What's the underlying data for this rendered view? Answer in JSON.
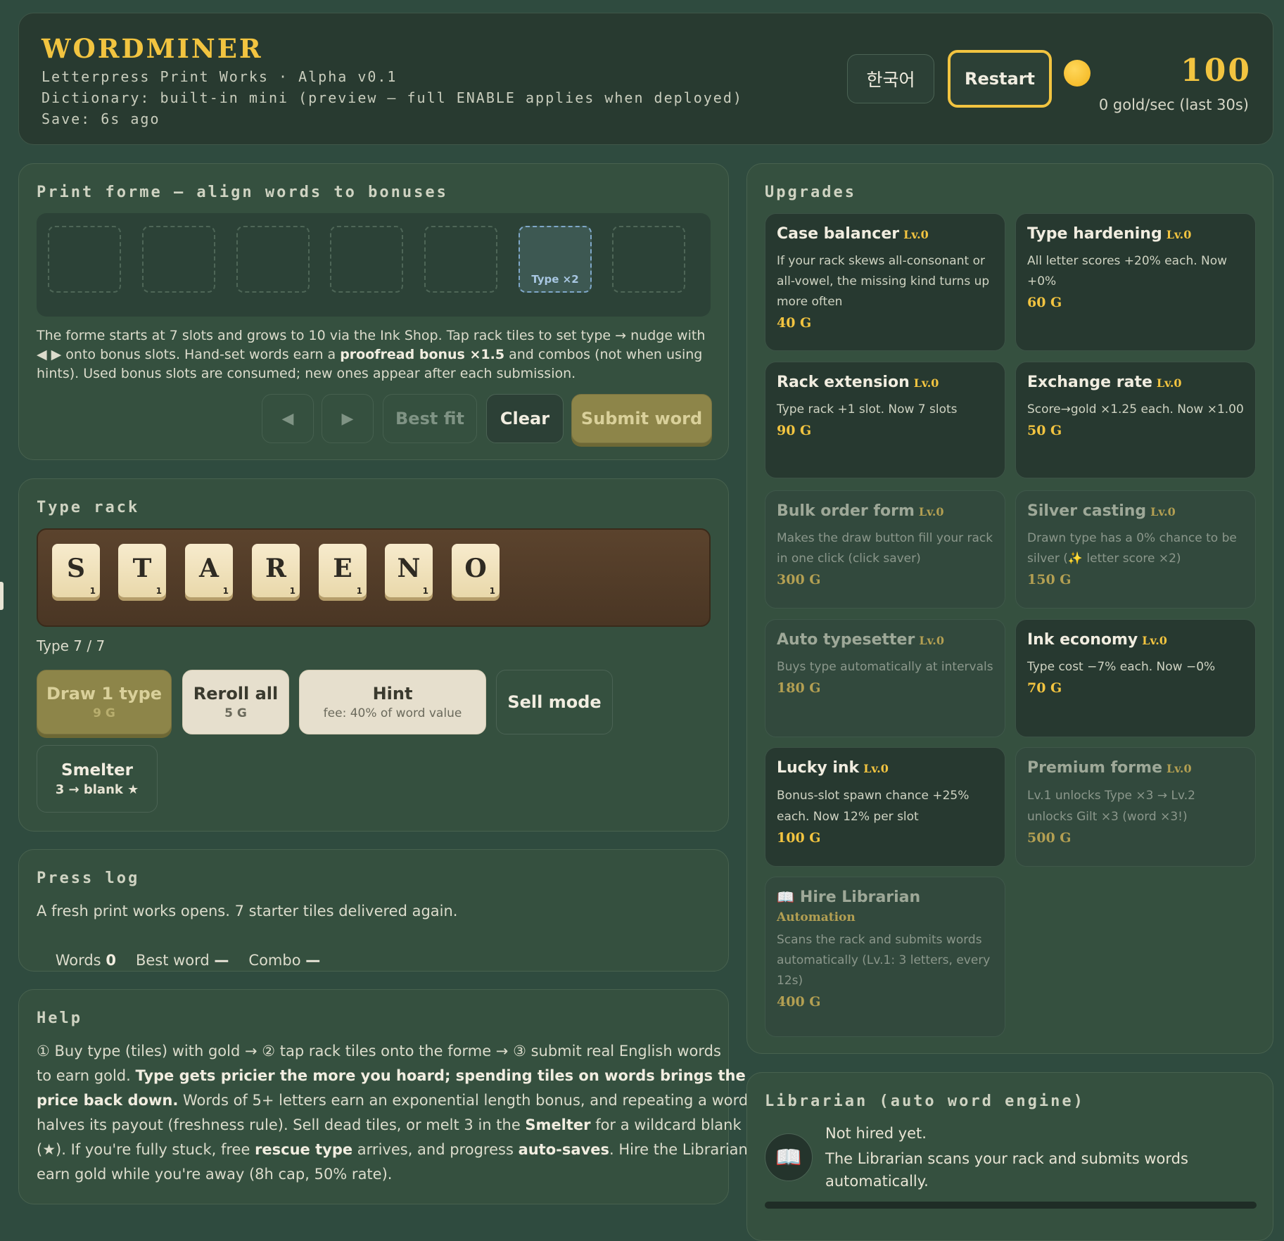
{
  "header": {
    "title": "WORDMINER",
    "subtitle": "Letterpress Print Works · Alpha v0.1",
    "dictionary": "Dictionary: built-in mini (preview — full ENABLE applies when deployed)",
    "save": "Save: 6s ago",
    "lang_label": "한국어",
    "restart_label": "Restart",
    "gold": "100",
    "rate": "0 gold/sec (last 30s)"
  },
  "forme": {
    "title": "Print forme — align words to bonuses",
    "bonus_label": "Type ×2",
    "bonus_slot": 6,
    "slots": 7,
    "desc_1": "The forme starts at 7 slots and grows to 10 via the Ink Shop. Tap rack tiles to set type → nudge with",
    "desc_2a": "◀ ▶  onto bonus slots. Hand-set words earn a ",
    "desc_2b": "proofread bonus ×1.5",
    "desc_2c": " and combos (not when using",
    "desc_3": "hints). Used bonus slots are consumed; new ones appear after each submission.",
    "left_label": "◀",
    "right_label": "▶",
    "bestfit_label": "Best fit",
    "clear_label": "Clear",
    "submit_label": "Submit word"
  },
  "rack": {
    "title": "Type rack",
    "tiles": [
      {
        "letter": "S",
        "points": "1"
      },
      {
        "letter": "T",
        "points": "1"
      },
      {
        "letter": "A",
        "points": "1"
      },
      {
        "letter": "R",
        "points": "1"
      },
      {
        "letter": "E",
        "points": "1"
      },
      {
        "letter": "N",
        "points": "1"
      },
      {
        "letter": "O",
        "points": "1"
      }
    ],
    "count": "Type 7 / 7",
    "draw_label": "Draw 1 type",
    "draw_cost": "9 G",
    "reroll_label": "Reroll all",
    "reroll_cost": "5 G",
    "hint_label": "Hint",
    "hint_cost": "fee: 40% of word value",
    "sell_label": "Sell mode",
    "smelter_label": "Smelter",
    "smelter_sub": "3 → blank ★"
  },
  "log": {
    "title": "Press log",
    "message": "A fresh print works opens. 7 starter tiles delivered again.",
    "words_label": "Words",
    "words_value": "0",
    "best_label": "Best word",
    "best_value": "—",
    "combo_label": "Combo",
    "combo_value": "—"
  },
  "help": {
    "title": "Help",
    "l1": "① Buy type (tiles) with gold → ② tap rack tiles onto the forme → ③ submit real English words",
    "l2a": "to earn gold. ",
    "l2b": "Type gets pricier the more you hoard; spending tiles on words brings the",
    "l3a": "price back down.",
    "l3b": " Words of 5+ letters earn an exponential length bonus, and repeating a word",
    "l4a": "halves its payout (freshness rule). Sell dead tiles, or melt 3 in the ",
    "l4b": "Smelter",
    "l4c": " for a wildcard blank",
    "l5a": "(★). If you're fully stuck, free ",
    "l5b": "rescue type",
    "l5c": " arrives, and progress ",
    "l5d": "auto-saves",
    "l5e": ". Hire the Librarian to",
    "l6": "earn gold while you're away (8h cap, 50% rate)."
  },
  "upgrades": {
    "title": "Upgrades",
    "items": [
      {
        "name": "Case balancer",
        "lv": "Lv.0",
        "desc": "If your rack skews all-consonant or all-vowel, the missing kind turns up more often",
        "cost": "40 G"
      },
      {
        "name": "Type hardening",
        "lv": "Lv.0",
        "desc": "All letter scores +20% each. Now +0%",
        "cost": "60 G"
      },
      {
        "name": "Rack extension",
        "lv": "Lv.0",
        "desc": "Type rack +1 slot. Now 7 slots",
        "cost": "90 G"
      },
      {
        "name": "Exchange rate",
        "lv": "Lv.0",
        "desc": "Score→gold ×1.25 each. Now ×1.00",
        "cost": "50 G"
      },
      {
        "name": "Bulk order form",
        "lv": "Lv.0",
        "desc": "Makes the draw button fill your rack in one click (click saver)",
        "cost": "300 G"
      },
      {
        "name": "Silver casting",
        "lv": "Lv.0",
        "desc": "Drawn type has a 0% chance to be silver (✨ letter score ×2)",
        "cost": "150 G"
      },
      {
        "name": "Auto typesetter",
        "lv": "Lv.0",
        "desc": "Buys type automatically at intervals",
        "cost": "180 G"
      },
      {
        "name": "Ink economy",
        "lv": "Lv.0",
        "desc": "Type cost −7% each. Now −0%",
        "cost": "70 G"
      },
      {
        "name": "Lucky ink",
        "lv": "Lv.0",
        "desc": "Bonus-slot spawn chance +25% each. Now 12% per slot",
        "cost": "100 G"
      },
      {
        "name": "Premium forme",
        "lv": "Lv.0",
        "desc": "Lv.1 unlocks Type ×3 → Lv.2 unlocks Gilt ×3 (word ×3!)",
        "cost": "500 G"
      }
    ],
    "hire": {
      "icon": "📖",
      "name": "Hire Librarian",
      "tag": "Automation",
      "desc": "Scans the rack and submits words automatically (Lv.1: 3 letters, every 12s)",
      "cost": "400 G"
    }
  },
  "librarian": {
    "title": "Librarian (auto word engine)",
    "icon": "📖",
    "status": "Not hired yet.",
    "desc": "The Librarian scans your rack and submits words automatically.",
    "progress": 0
  },
  "colors": {
    "bg": "#2f4b3f",
    "panel": "#35503f",
    "gold": "#f2c440",
    "tile": "#f0e2bb",
    "rack": "#4e3a28"
  }
}
